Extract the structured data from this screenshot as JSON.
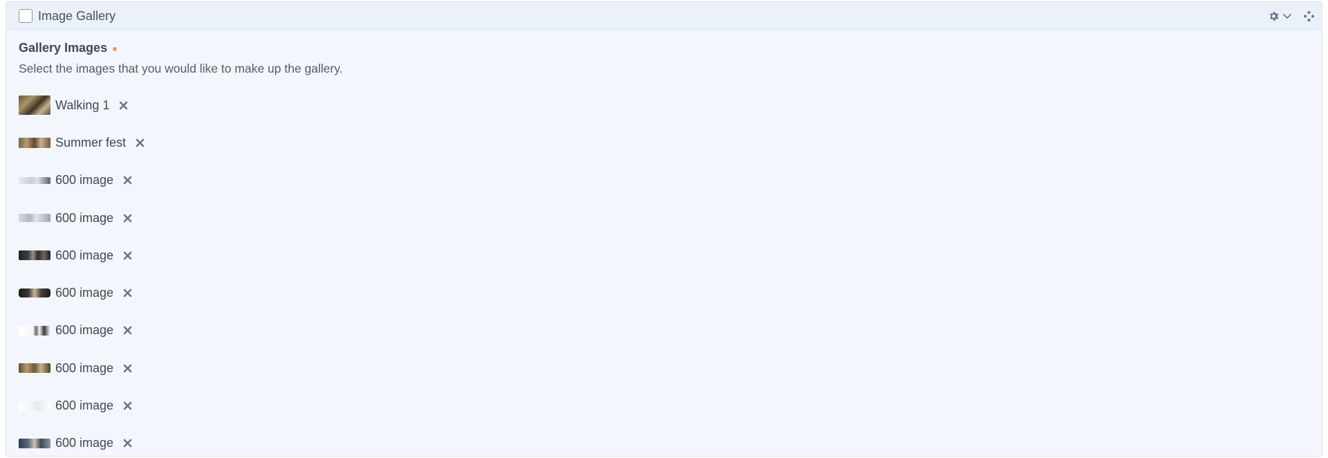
{
  "block": {
    "title": "Image Gallery"
  },
  "field": {
    "title": "Gallery Images",
    "description": "Select the images that you would like to make up the gallery."
  },
  "images": [
    {
      "label": "Walking 1"
    },
    {
      "label": "Summer fest"
    },
    {
      "label": "600 image"
    },
    {
      "label": "600 image"
    },
    {
      "label": "600 image"
    },
    {
      "label": "600 image"
    },
    {
      "label": "600 image"
    },
    {
      "label": "600 image"
    },
    {
      "label": "600 image"
    },
    {
      "label": "600 image"
    }
  ],
  "icons": {
    "settings": "gear-icon",
    "expand": "chevron-down-icon",
    "move": "move-handle-icon",
    "remove": "remove-x-icon"
  },
  "colors": {
    "panel_background": "#f3f7fd",
    "header_background": "#eaf1fb",
    "required_indicator": "#d9a36b",
    "text": "#3f4755"
  }
}
